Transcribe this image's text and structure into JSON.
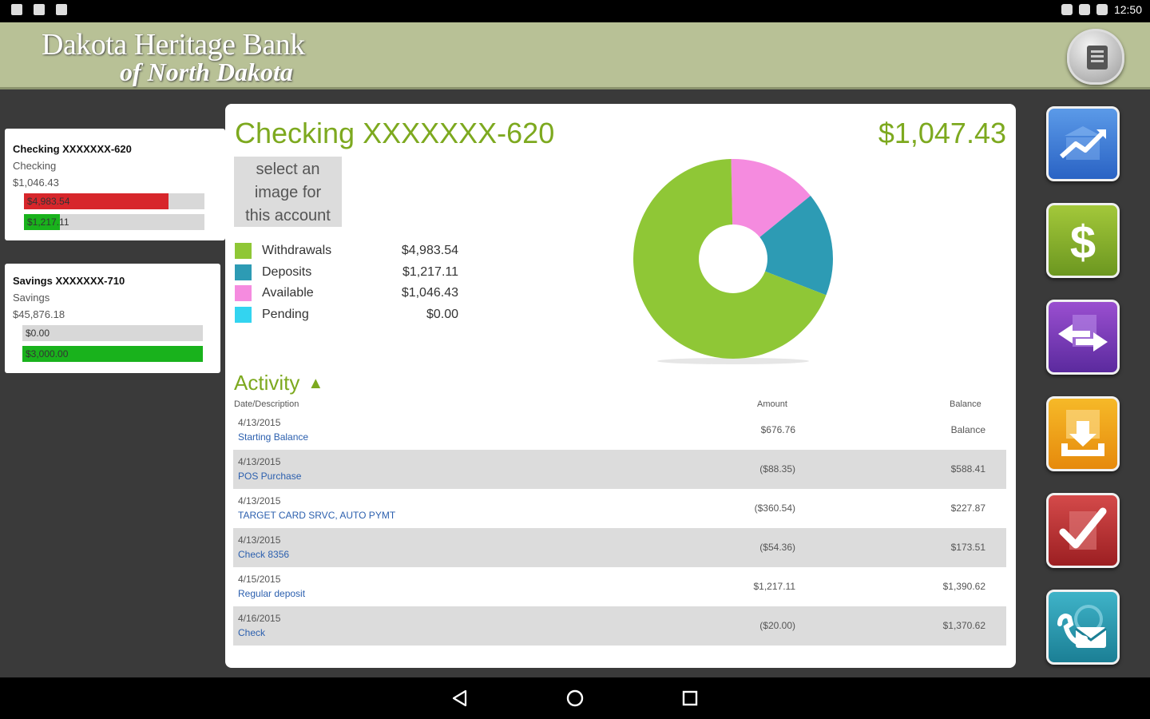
{
  "status_bar": {
    "time": "12:50"
  },
  "header": {
    "bank_name_line1": "Dakota Heritage Bank",
    "bank_name_line2": "of North Dakota"
  },
  "accounts": [
    {
      "title": "Checking XXXXXXX-620",
      "type": "Checking",
      "balance": "$1,046.43",
      "bar1_label": "$4,983.54",
      "bar1_fill_fraction": 0.8,
      "bar1_color": "#d7262b",
      "bar2_label": "$1,217.11",
      "bar2_fill_fraction": 0.2,
      "bar2_color": "#19b21c"
    },
    {
      "title": "Savings XXXXXXX-710",
      "type": "Savings",
      "balance": "$45,876.18",
      "bar1_label": "$0.00",
      "bar1_fill_fraction": 0,
      "bar1_color": "#d7262b",
      "bar2_label": "$3,000.00",
      "bar2_fill_fraction": 1,
      "bar2_color": "#19b21c"
    }
  ],
  "main": {
    "account_title": "Checking XXXXXXX-620",
    "account_balance": "$1,047.43",
    "image_prompt": [
      "select an",
      "image for",
      "this account"
    ],
    "activity_label": "Activity",
    "columns": {
      "date_desc": "Date/Description",
      "amount": "Amount",
      "balance": "Balance"
    }
  },
  "chart_data": {
    "type": "pie",
    "style": "donut",
    "categories": [
      "Withdrawals",
      "Deposits",
      "Available",
      "Pending"
    ],
    "values": [
      4983.54,
      1217.11,
      1046.43,
      0.0
    ],
    "value_labels": [
      "$4,983.54",
      "$1,217.11",
      "$1,046.43",
      "$0.00"
    ],
    "colors": [
      "#8fc736",
      "#2d9bb4",
      "#f58bdf",
      "#33d4f0"
    ]
  },
  "transactions": [
    {
      "date": "4/13/2015",
      "description": "Starting Balance",
      "amount": "$676.76",
      "balance": "Balance"
    },
    {
      "date": "4/13/2015",
      "description": "POS Purchase",
      "amount": "($88.35)",
      "balance": "$588.41"
    },
    {
      "date": "4/13/2015",
      "description": "TARGET CARD SRVC, AUTO PYMT",
      "amount": "($360.54)",
      "balance": "$227.87"
    },
    {
      "date": "4/13/2015",
      "description": "Check 8356",
      "amount": "($54.36)",
      "balance": "$173.51"
    },
    {
      "date": "4/15/2015",
      "description": "Regular deposit",
      "amount": "$1,217.11",
      "balance": "$1,390.62"
    },
    {
      "date": "4/16/2015",
      "description": "Check",
      "amount": "($20.00)",
      "balance": "$1,370.62"
    }
  ],
  "nav_icons": [
    "accounts-chart-icon",
    "dollar-icon",
    "transfer-icon",
    "deposit-icon",
    "checklist-icon",
    "contact-icon"
  ],
  "colors": {
    "accent_green": "#7da91f",
    "header_bg": "#b8c196",
    "link_blue": "#2b5fae"
  }
}
